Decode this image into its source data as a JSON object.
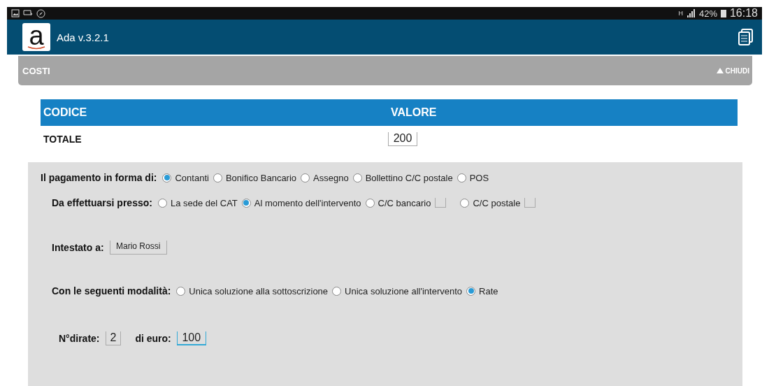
{
  "status_bar": {
    "signal_text": "H",
    "battery": "42%",
    "time": "16:18"
  },
  "app_bar": {
    "logo_letter": "a",
    "title": "Ada v.3.2.1"
  },
  "section": {
    "title": "COSTI",
    "toggle": "CHIUDI",
    "expanded": true
  },
  "table": {
    "columns": [
      "CODICE",
      "VALORE"
    ],
    "rows": [
      {
        "code": "TOTALE",
        "value": "200"
      }
    ]
  },
  "form": {
    "payment": {
      "label": "Il pagamento in forma di:",
      "options": [
        {
          "label": "Contanti",
          "selected": true
        },
        {
          "label": "Bonifico Bancario",
          "selected": false
        },
        {
          "label": "Assegno",
          "selected": false
        },
        {
          "label": "Bollettino C/C postale",
          "selected": false
        },
        {
          "label": "POS",
          "selected": false
        }
      ]
    },
    "place": {
      "label": "Da effettuarsi presso:",
      "options": [
        {
          "label": "La sede del CAT",
          "selected": false,
          "kind": "plain"
        },
        {
          "label": "Al momento dell'intervento",
          "selected": true,
          "kind": "plain"
        },
        {
          "label": "C/C bancario",
          "selected": false,
          "kind": "with_field"
        },
        {
          "label": "C/C postale",
          "selected": false,
          "kind": "with_field"
        }
      ]
    },
    "holder": {
      "label": "Intestato a:",
      "value": "Mario Rossi"
    },
    "mode": {
      "label": "Con le seguenti modalità:",
      "options": [
        {
          "label": "Unica soluzione alla sottoscrizione",
          "selected": false
        },
        {
          "label": "Unica soluzione all'intervento",
          "selected": false
        },
        {
          "label": "Rate",
          "selected": true
        }
      ]
    },
    "installments": [
      {
        "label": "N°dirate:",
        "value": "2",
        "focused": false
      },
      {
        "label": "di euro:",
        "value": "100",
        "focused": true
      }
    ]
  }
}
